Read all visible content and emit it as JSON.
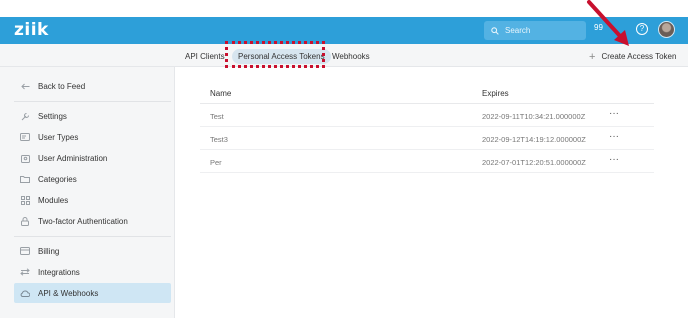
{
  "app": {
    "logo": "ziik"
  },
  "header": {
    "search_placeholder": "Search",
    "notification_count": "99",
    "help_label": "?"
  },
  "tabs": [
    {
      "label": "API Clients"
    },
    {
      "label": "Personal Access Tokens",
      "active": true
    },
    {
      "label": "Webhooks"
    }
  ],
  "actions": {
    "create_token_label": "Create Access Token",
    "create_token_icon": "plus-icon"
  },
  "sidebar": {
    "items": [
      {
        "label": "Back to Feed",
        "icon": "back-arrow-icon"
      },
      {
        "label": "Settings",
        "icon": "wrench-icon"
      },
      {
        "label": "User Types",
        "icon": "id-card-icon"
      },
      {
        "label": "User Administration",
        "icon": "user-admin-icon"
      },
      {
        "label": "Categories",
        "icon": "folder-icon"
      },
      {
        "label": "Modules",
        "icon": "grid-icon"
      },
      {
        "label": "Two-factor Authentication",
        "icon": "lock-icon"
      },
      {
        "label": "Billing",
        "icon": "credit-card-icon"
      },
      {
        "label": "Integrations",
        "icon": "arrows-exchange-icon"
      },
      {
        "label": "API & Webhooks",
        "icon": "cloud-icon",
        "active": true
      }
    ]
  },
  "table": {
    "columns": {
      "name": "Name",
      "expires": "Expires"
    },
    "rows": [
      {
        "name": "Test",
        "expires": "2022-09-11T10:34:21.000000Z",
        "menu": "···"
      },
      {
        "name": "Test3",
        "expires": "2022-09-12T14:19:12.000000Z",
        "menu": "···"
      },
      {
        "name": "Per",
        "expires": "2022-07-01T12:20:51.000000Z",
        "menu": "···"
      }
    ]
  },
  "colors": {
    "header": "#2d9fd9",
    "active_nav": "#cfe6f4",
    "annotation": "#c8102e"
  }
}
